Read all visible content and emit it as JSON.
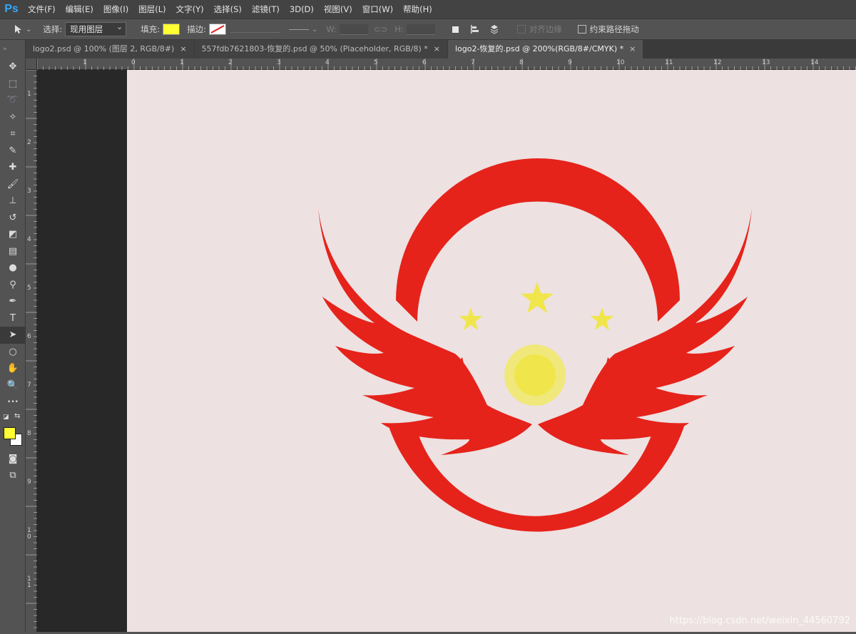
{
  "app": {
    "logo_text": "Ps"
  },
  "menu": [
    "文件(F)",
    "编辑(E)",
    "图像(I)",
    "图层(L)",
    "文字(Y)",
    "选择(S)",
    "滤镜(T)",
    "3D(D)",
    "视图(V)",
    "窗口(W)",
    "帮助(H)"
  ],
  "options": {
    "select_label": "选择:",
    "select_value": "现用图层",
    "fill_label": "填充:",
    "fill_color": "#ffff33",
    "stroke_label": "描边:",
    "w_label": "W:",
    "h_label": "H:",
    "align_edges_label": "对齐边缘",
    "constrain_path_label": "约束路径拖动"
  },
  "tabs": [
    {
      "label": "logo2.psd @ 100% (图层 2, RGB/8#)",
      "active": false
    },
    {
      "label": "557fdb7621803-恢复的.psd @ 50% (Placeholder, RGB/8) *",
      "active": false
    },
    {
      "label": "logo2-恢复的.psd @ 200%(RGB/8#/CMYK) *",
      "active": true
    }
  ],
  "tab_close_glyph": "×",
  "tools": [
    {
      "name": "move-tool-icon",
      "glyph": "✥"
    },
    {
      "name": "marquee-tool-icon",
      "glyph": "⬚"
    },
    {
      "name": "lasso-tool-icon",
      "glyph": "➰"
    },
    {
      "name": "magic-wand-tool-icon",
      "glyph": "✧"
    },
    {
      "name": "crop-tool-icon",
      "glyph": "⌗"
    },
    {
      "name": "eyedropper-tool-icon",
      "glyph": "✎"
    },
    {
      "name": "healing-brush-tool-icon",
      "glyph": "✚"
    },
    {
      "name": "brush-tool-icon",
      "glyph": "🖌"
    },
    {
      "name": "stamp-tool-icon",
      "glyph": "⊥"
    },
    {
      "name": "history-brush-tool-icon",
      "glyph": "↺"
    },
    {
      "name": "eraser-tool-icon",
      "glyph": "◩"
    },
    {
      "name": "gradient-tool-icon",
      "glyph": "▤"
    },
    {
      "name": "blur-tool-icon",
      "glyph": "●"
    },
    {
      "name": "dodge-tool-icon",
      "glyph": "⚲"
    },
    {
      "name": "pen-tool-icon",
      "glyph": "✒"
    },
    {
      "name": "type-tool-icon",
      "glyph": "T"
    },
    {
      "name": "path-selection-tool-icon",
      "glyph": "➤",
      "active": true
    },
    {
      "name": "ellipse-tool-icon",
      "glyph": "○"
    },
    {
      "name": "hand-tool-icon",
      "glyph": "✋"
    },
    {
      "name": "zoom-tool-icon",
      "glyph": "🔍"
    },
    {
      "name": "more-tools-icon",
      "glyph": "•••"
    }
  ],
  "colors": {
    "foreground": "#ffff33",
    "background": "#ffffff",
    "logo_red": "#e5231b",
    "logo_yellow": "#f0e64b",
    "canvas_bg": "#ede1e1"
  },
  "ruler_top_labels": [
    "1",
    "0",
    "1",
    "2",
    "3",
    "4",
    "5",
    "6",
    "7",
    "8",
    "9",
    "10",
    "11",
    "12",
    "13",
    "14"
  ],
  "ruler_left_labels": [
    "1",
    "2",
    "3",
    "4",
    "5",
    "6",
    "7",
    "8",
    "9",
    "1 0",
    "1 1"
  ],
  "watermark": "https://blog.csdn.net/weixin_44560792"
}
